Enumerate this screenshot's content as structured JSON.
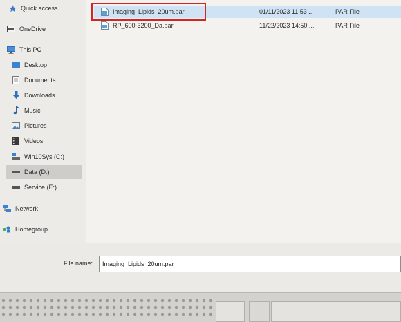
{
  "sidebar": {
    "items": [
      {
        "label": "Quick access",
        "icon": "star-icon"
      },
      {
        "label": "OneDrive",
        "icon": "onedrive-icon"
      },
      {
        "label": "This PC",
        "icon": "computer-icon"
      },
      {
        "label": "Desktop",
        "icon": "desktop-icon"
      },
      {
        "label": "Documents",
        "icon": "documents-icon"
      },
      {
        "label": "Downloads",
        "icon": "download-arrow-icon"
      },
      {
        "label": "Music",
        "icon": "music-note-icon"
      },
      {
        "label": "Pictures",
        "icon": "pictures-icon"
      },
      {
        "label": "Videos",
        "icon": "video-icon"
      },
      {
        "label": "Win10Sys (C:)",
        "icon": "drive-c-icon"
      },
      {
        "label": "Data (D:)",
        "icon": "drive-icon"
      },
      {
        "label": "Service (E:)",
        "icon": "drive-icon"
      },
      {
        "label": "Network",
        "icon": "network-icon"
      },
      {
        "label": "Homegroup",
        "icon": "homegroup-icon"
      }
    ],
    "selected": "Data (D:)"
  },
  "files": [
    {
      "name": "Imaging_Lipids_20um.par",
      "date": "01/11/2023 11:53 ...",
      "type": "PAR File",
      "selected": true
    },
    {
      "name": "RP_600-3200_Da.par",
      "date": "11/22/2023 14:50 ...",
      "type": "PAR File",
      "selected": false
    }
  ],
  "filename": {
    "label": "File name:",
    "value": "Imaging_Lipids_20um.par"
  },
  "colors": {
    "selection": "#cfe3f5",
    "highlight_box": "#d42525",
    "nav_selected": "#cfcdca"
  }
}
